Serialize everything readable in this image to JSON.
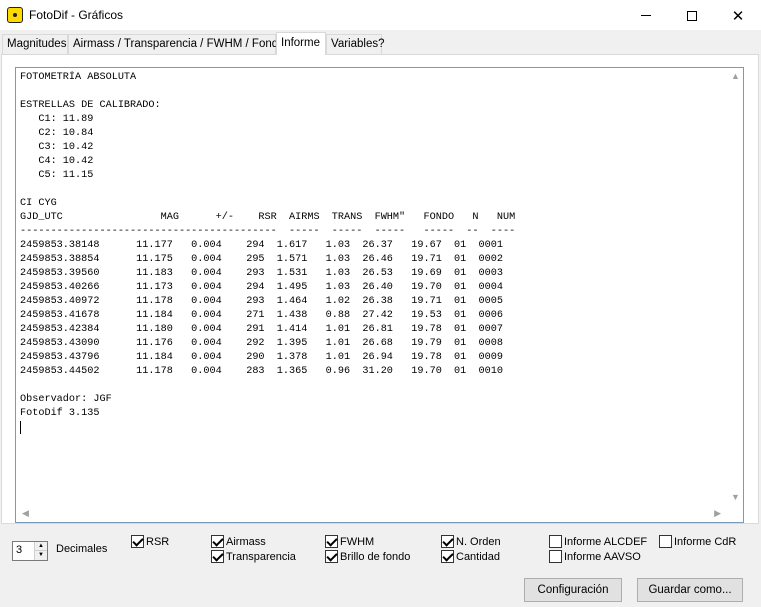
{
  "window": {
    "title": "FotoDif - Gráficos"
  },
  "tabs": [
    {
      "label": "Magnitudes"
    },
    {
      "label": "Airmass / Transparencia / FWHM / Fondo"
    },
    {
      "label": "Informe"
    },
    {
      "label": "Variables?"
    }
  ],
  "report": {
    "lines": [
      "FOTOMETRÍA ABSOLUTA",
      "",
      "ESTRELLAS DE CALIBRADO:",
      "   C1: 11.89",
      "   C2: 10.84",
      "   C3: 10.42",
      "   C4: 10.42",
      "   C5: 11.15",
      "",
      "CI CYG",
      "GJD_UTC                MAG      +/-    RSR  AIRMS  TRANS  FWHM\"   FONDO   N   NUM",
      "------------------------------------------  -----  -----  -----   -----  --  ----",
      "2459853.38148      11.177   0.004    294  1.617   1.03  26.37   19.67  01  0001",
      "2459853.38854      11.175   0.004    295  1.571   1.03  26.46   19.71  01  0002",
      "2459853.39560      11.183   0.004    293  1.531   1.03  26.53   19.69  01  0003",
      "2459853.40266      11.173   0.004    294  1.495   1.03  26.40   19.70  01  0004",
      "2459853.40972      11.178   0.004    293  1.464   1.02  26.38   19.71  01  0005",
      "2459853.41678      11.184   0.004    271  1.438   0.88  27.42   19.53  01  0006",
      "2459853.42384      11.180   0.004    291  1.414   1.01  26.81   19.78  01  0007",
      "2459853.43090      11.176   0.004    292  1.395   1.01  26.68   19.79  01  0008",
      "2459853.43796      11.184   0.004    290  1.378   1.01  26.94   19.78  01  0009",
      "2459853.44502      11.178   0.004    283  1.365   0.96  31.20   19.70  01  0010",
      "",
      "Observador: JGF",
      "FotoDif 3.135"
    ]
  },
  "decimals": {
    "value": "3",
    "label": "Decimales"
  },
  "options": {
    "rsr": {
      "label": "RSR",
      "checked": true
    },
    "airmass": {
      "label": "Airmass",
      "checked": true
    },
    "transparencia": {
      "label": "Transparencia",
      "checked": true
    },
    "fwhm": {
      "label": "FWHM",
      "checked": true
    },
    "brillo_fondo": {
      "label": "Brillo de fondo",
      "checked": true
    },
    "n_orden": {
      "label": "N. Orden",
      "checked": true
    },
    "cantidad": {
      "label": "Cantidad",
      "checked": true
    },
    "informe_alcdef": {
      "label": "Informe ALCDEF",
      "checked": false
    },
    "informe_aavso": {
      "label": "Informe AAVSO",
      "checked": false
    },
    "informe_cdr": {
      "label": "Informe CdR",
      "checked": false
    }
  },
  "buttons": {
    "configuracion": "Configuración",
    "guardar": "Guardar como..."
  }
}
